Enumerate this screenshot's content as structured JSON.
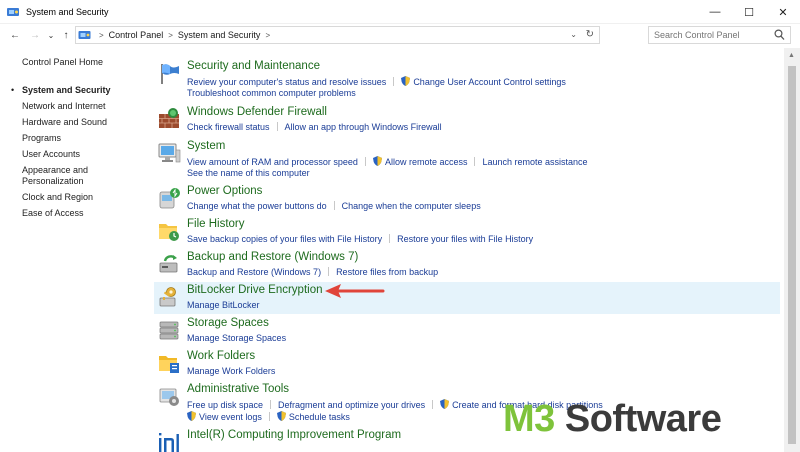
{
  "window": {
    "title": "System and Security",
    "controls": {
      "minimize": "—",
      "maximize": "☐",
      "close": "✕"
    }
  },
  "nav": {
    "back": "←",
    "forward": "→",
    "recent": "⌄",
    "up": "↑"
  },
  "address": {
    "crumbs": [
      "Control Panel",
      "System and Security"
    ],
    "separator": ">"
  },
  "search": {
    "placeholder": "Search Control Panel"
  },
  "sidebar": {
    "home": "Control Panel Home",
    "items": [
      {
        "label": "System and Security",
        "active": true
      },
      {
        "label": "Network and Internet"
      },
      {
        "label": "Hardware and Sound"
      },
      {
        "label": "Programs"
      },
      {
        "label": "User Accounts"
      },
      {
        "label": "Appearance and Personalization"
      },
      {
        "label": "Clock and Region"
      },
      {
        "label": "Ease of Access"
      }
    ]
  },
  "categories": {
    "security": {
      "title": "Security and Maintenance",
      "links": [
        "Review your computer's status and resolve issues",
        "Change User Account Control settings",
        "Troubleshoot common computer problems"
      ]
    },
    "firewall": {
      "title": "Windows Defender Firewall",
      "links": [
        "Check firewall status",
        "Allow an app through Windows Firewall"
      ]
    },
    "system": {
      "title": "System",
      "links": [
        "View amount of RAM and processor speed",
        "Allow remote access",
        "Launch remote assistance",
        "See the name of this computer"
      ]
    },
    "power": {
      "title": "Power Options",
      "links": [
        "Change what the power buttons do",
        "Change when the computer sleeps"
      ]
    },
    "filehistory": {
      "title": "File History",
      "links": [
        "Save backup copies of your files with File History",
        "Restore your files with File History"
      ]
    },
    "backup": {
      "title": "Backup and Restore (Windows 7)",
      "links": [
        "Backup and Restore (Windows 7)",
        "Restore files from backup"
      ]
    },
    "bitlocker": {
      "title": "BitLocker Drive Encryption",
      "links": [
        "Manage BitLocker"
      ]
    },
    "storage": {
      "title": "Storage Spaces",
      "links": [
        "Manage Storage Spaces"
      ]
    },
    "workfolders": {
      "title": "Work Folders",
      "links": [
        "Manage Work Folders"
      ]
    },
    "admintools": {
      "title": "Administrative Tools",
      "links": [
        "Free up disk space",
        "Defragment and optimize your drives",
        "Create and format hard disk partitions",
        "View event logs",
        "Schedule tasks"
      ]
    },
    "intel": {
      "title": "Intel(R) Computing Improvement Program"
    }
  },
  "watermark": {
    "part1": "M3",
    "part2": " Software"
  },
  "colors": {
    "category_title": "#1e6b1e",
    "link": "#1a3c96",
    "highlight": "#e5f3fb",
    "arrow": "#e0443a"
  }
}
